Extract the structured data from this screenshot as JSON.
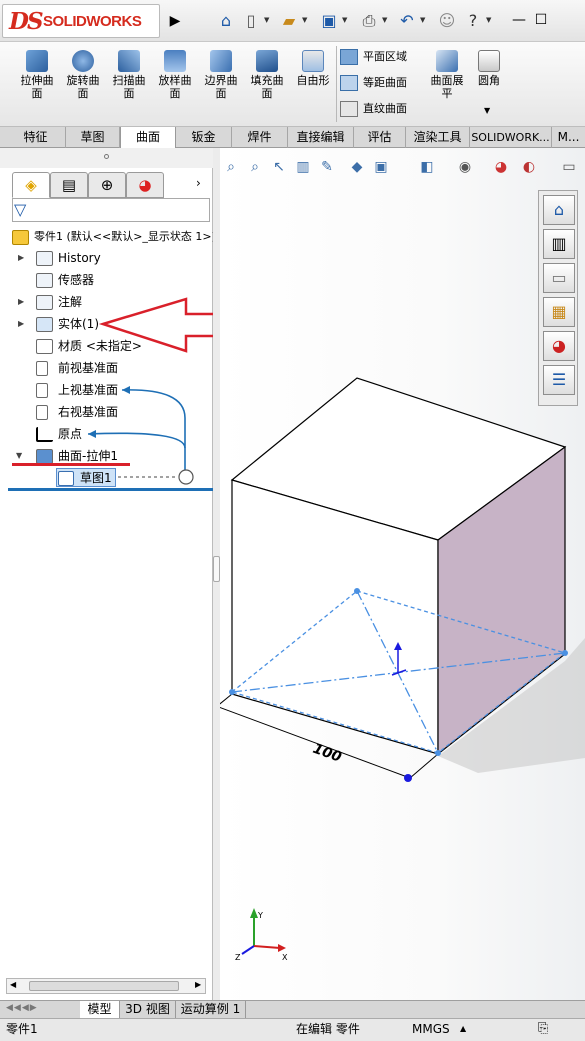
{
  "app": {
    "logo_ds": "DS",
    "logo_text": "SOLIDWORKS"
  },
  "quick_access": {
    "icons": [
      "home-icon",
      "new-document-icon",
      "open-icon",
      "save-icon",
      "print-icon",
      "undo-icon",
      "user-icon",
      "help-icon",
      "minimize-icon",
      "maximize-icon"
    ],
    "help_glyph": "?"
  },
  "command_bar": {
    "buttons": [
      {
        "label": "拉伸曲\n面"
      },
      {
        "label": "旋转曲\n面"
      },
      {
        "label": "扫描曲\n面"
      },
      {
        "label": "放样曲\n面"
      },
      {
        "label": "边界曲\n面"
      },
      {
        "label": "填充曲\n面"
      },
      {
        "label": "自由形"
      }
    ],
    "small_buttons": [
      "平面区域",
      "等距曲面",
      "直纹曲面"
    ],
    "unfold_label": "曲面展\n平",
    "fillet_label": "圆角"
  },
  "tabs": [
    "特征",
    "草图",
    "曲面",
    "钣金",
    "焊件",
    "直接编辑",
    "评估",
    "渲染工具",
    "SOLIDWORK...",
    "M..."
  ],
  "active_tab": "曲面",
  "feature_tree": {
    "root": "零件1 (默认<<默认>_显示状态 1>)",
    "items": [
      {
        "label": "History",
        "expandable": true
      },
      {
        "label": "传感器",
        "expandable": false
      },
      {
        "label": "注解",
        "expandable": true
      },
      {
        "label": "实体(1)",
        "expandable": true
      },
      {
        "label": "材质 <未指定>",
        "expandable": false
      },
      {
        "label": "前视基准面",
        "expandable": false
      },
      {
        "label": "上视基准面",
        "expandable": false
      },
      {
        "label": "右视基准面",
        "expandable": false
      },
      {
        "label": "原点",
        "expandable": false
      },
      {
        "label": "曲面-拉伸1",
        "expandable": true,
        "expanded": true
      },
      {
        "label": "草图1",
        "expandable": false,
        "selected": true
      }
    ]
  },
  "viewport": {
    "dimension_label": "100",
    "colors": {
      "side_face": "#c7b3c6",
      "sketch_line": "#4a90e2",
      "annotation_arrow": "#d9202a",
      "link_line": "#1e6fb5"
    }
  },
  "bottom_tabs": [
    "模型",
    "3D 视图",
    "运动算例 1"
  ],
  "active_bottom_tab": "模型",
  "status_bar": {
    "part_name": "零件1",
    "mode": "在编辑 零件",
    "units": "MMGS"
  }
}
